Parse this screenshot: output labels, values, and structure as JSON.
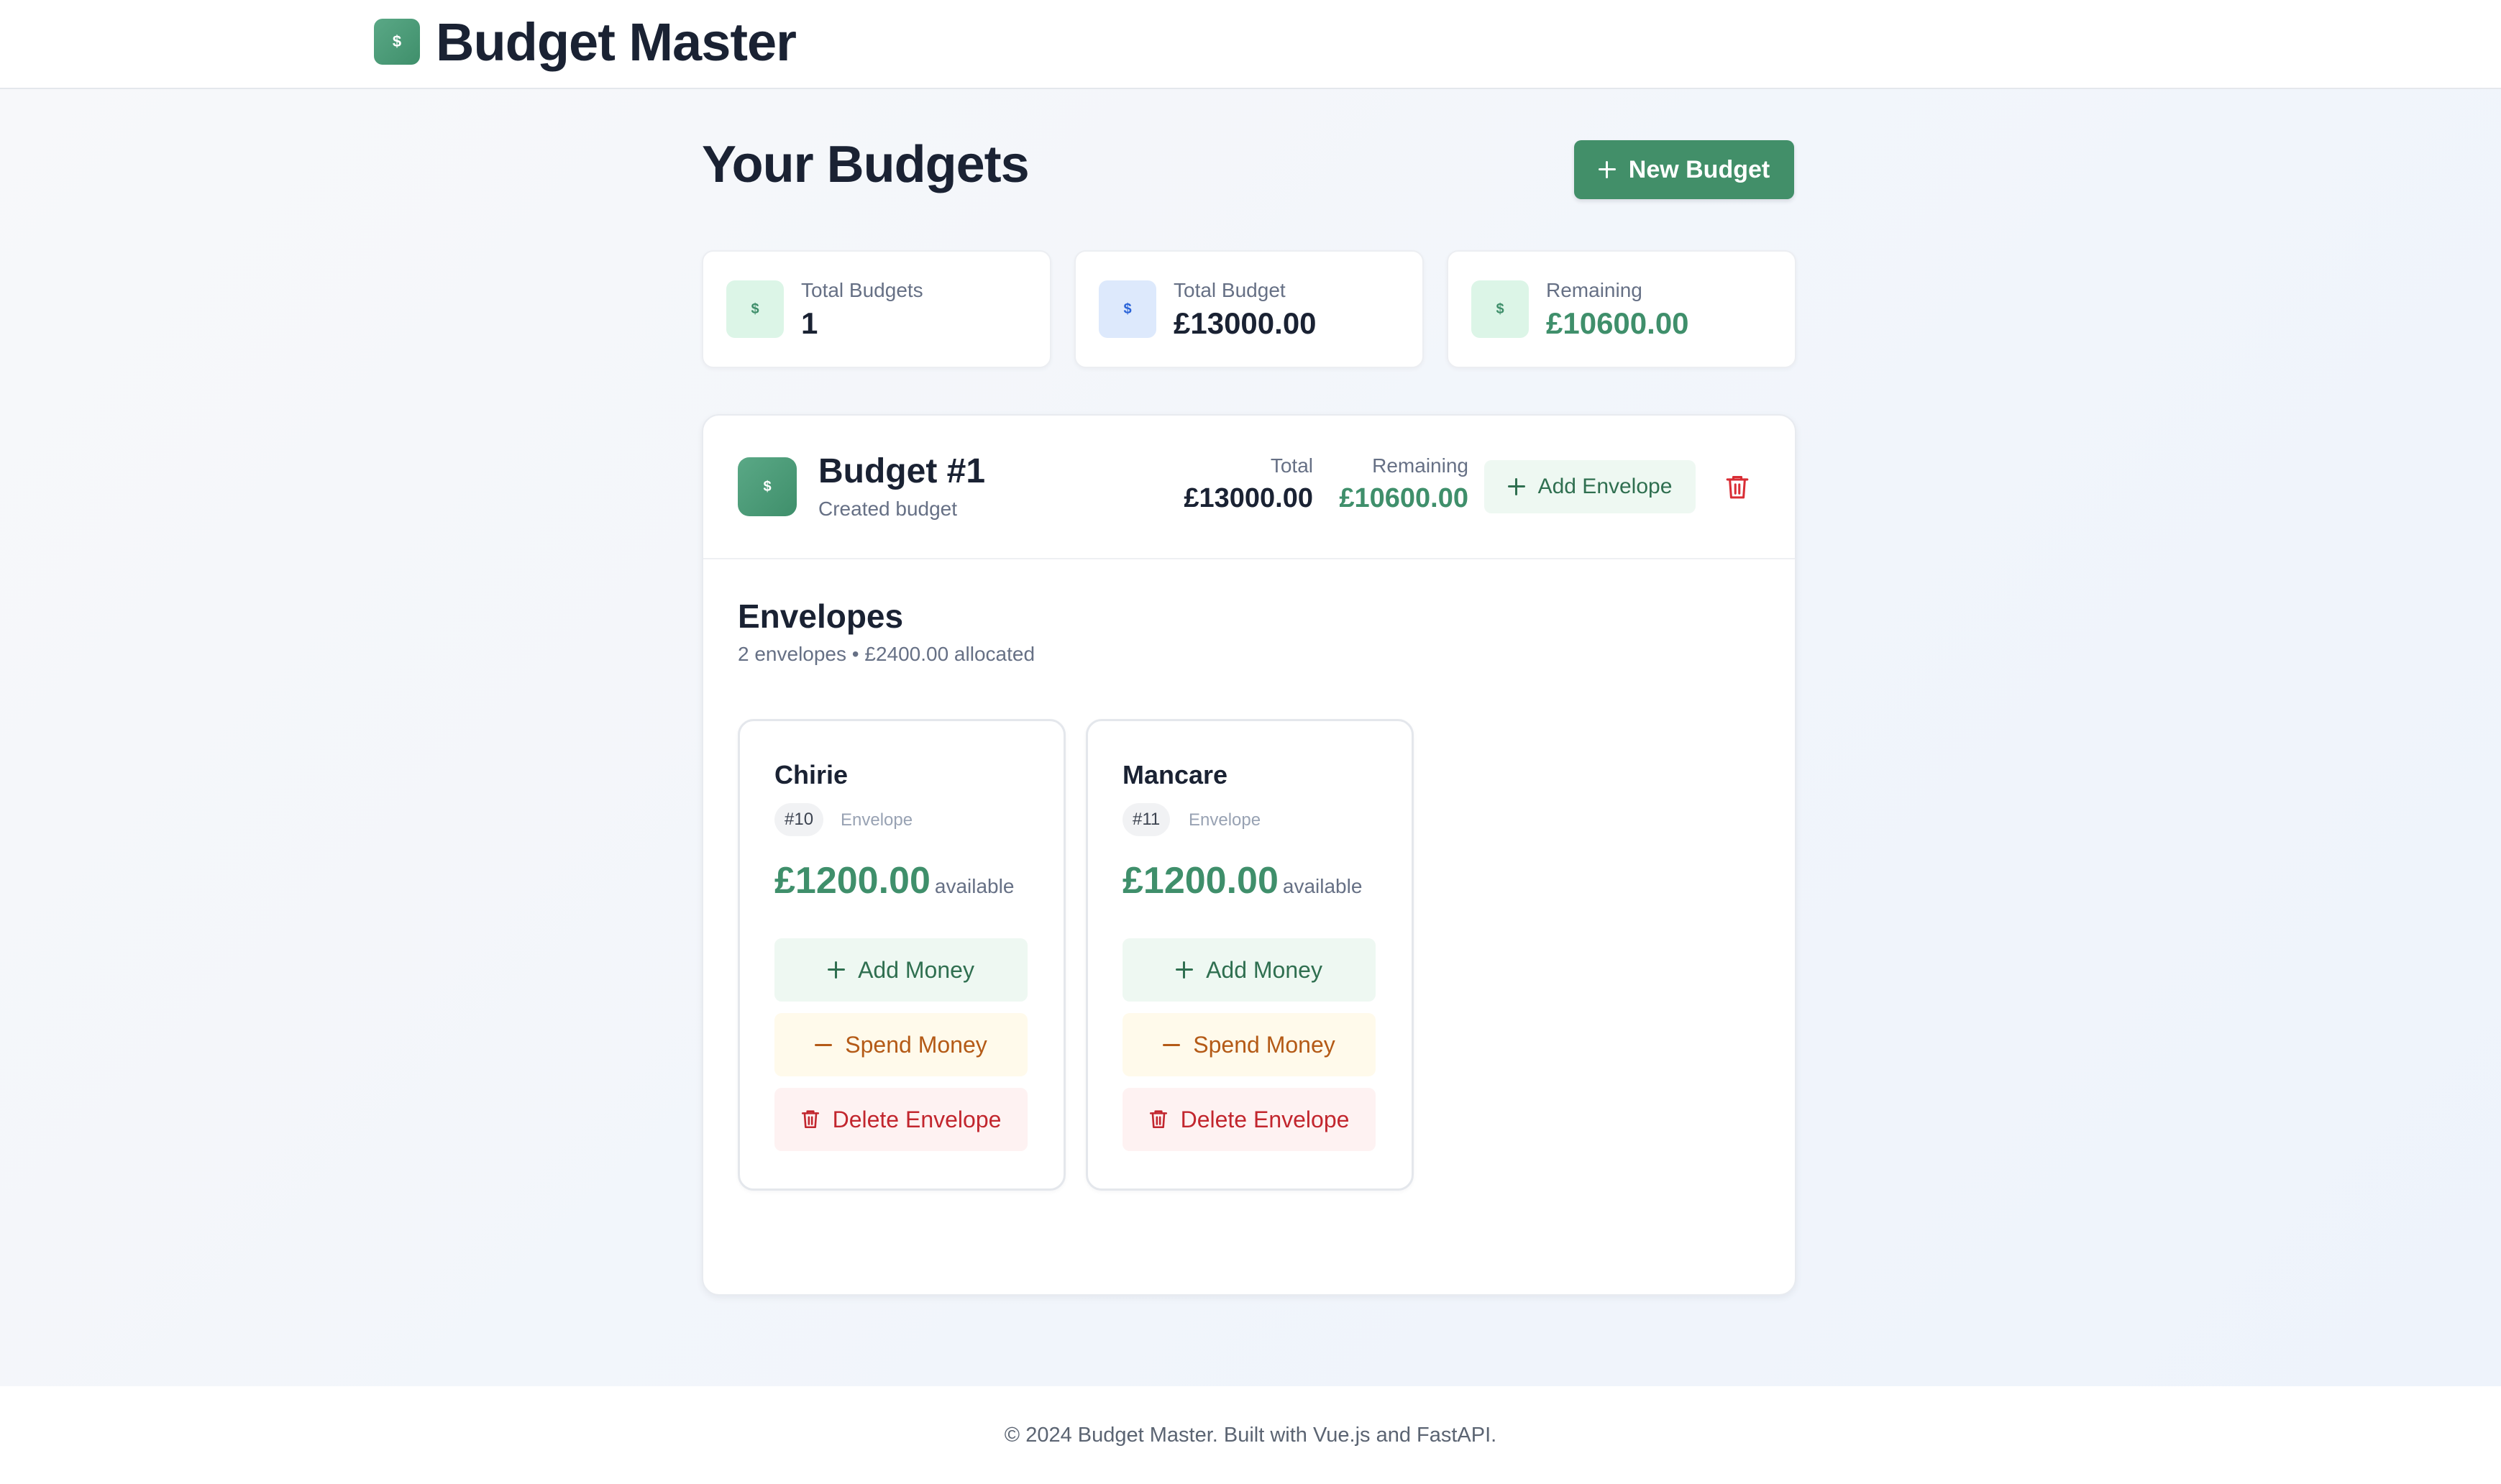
{
  "header": {
    "logo_symbol": "$",
    "app_title": "Budget Master"
  },
  "page": {
    "title": "Your Budgets",
    "new_budget_label": "New Budget"
  },
  "stats": [
    {
      "label": "Total Budgets",
      "value": "1",
      "symbol": "$",
      "icon_bg": "#dcf5e7",
      "icon_color": "#3f8f6b"
    },
    {
      "label": "Total Budget",
      "value": "£13000.00",
      "symbol": "$",
      "icon_bg": "#dde9fc",
      "icon_color": "#2b64d8"
    },
    {
      "label": "Remaining",
      "value": "£10600.00",
      "symbol": "$",
      "icon_bg": "#dcf5e7",
      "icon_color": "#3f8f6b"
    }
  ],
  "budget": {
    "symbol": "$",
    "name": "Budget #1",
    "subtitle": "Created budget",
    "total_label": "Total",
    "total_value": "£13000.00",
    "remaining_label": "Remaining",
    "remaining_value": "£10600.00",
    "add_envelope_label": "Add Envelope",
    "envelopes_title": "Envelopes",
    "envelopes_summary": "2 envelopes • £2400.00 allocated",
    "envelopes": [
      {
        "name": "Chirie",
        "id": "#10",
        "tag": "Envelope",
        "amount": "£1200.00",
        "available_label": "available",
        "add_label": "Add Money",
        "spend_label": "Spend Money",
        "delete_label": "Delete Envelope"
      },
      {
        "name": "Mancare",
        "id": "#11",
        "tag": "Envelope",
        "amount": "£1200.00",
        "available_label": "available",
        "add_label": "Add Money",
        "spend_label": "Spend Money",
        "delete_label": "Delete Envelope"
      }
    ]
  },
  "footer": {
    "text": "© 2024 Budget Master. Built with Vue.js and FastAPI."
  },
  "colors": {
    "accent": "#428f69",
    "positive": "#3f8f6b",
    "danger": "#c2262e",
    "warning": "#b45a16"
  }
}
